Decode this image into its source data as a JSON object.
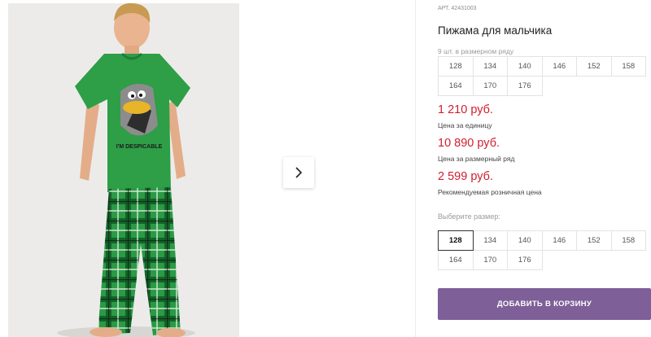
{
  "product": {
    "article_label": "АРТ. 42431003",
    "title": "Пижама для мальчика",
    "shirt_print_text": "I'M DESPICABLE"
  },
  "pack": {
    "note": "9 шт. в размерном ряду",
    "sizes": [
      "128",
      "134",
      "140",
      "146",
      "152",
      "158",
      "164",
      "170",
      "176"
    ]
  },
  "prices": [
    {
      "value": "1 210 руб.",
      "label": "Цена за единицу"
    },
    {
      "value": "10 890 руб.",
      "label": "Цена за размерный ряд"
    },
    {
      "value": "2 599 руб.",
      "label": "Рекомендуемая розничная цена"
    }
  ],
  "size_select": {
    "label": "Выберите размер:",
    "sizes": [
      "128",
      "134",
      "140",
      "146",
      "152",
      "158",
      "164",
      "170",
      "176"
    ],
    "selected": "128"
  },
  "add_to_cart_label": "ДОБАВИТЬ В КОРЗИНУ",
  "colors": {
    "price_red": "#cf1f2e",
    "button_purple": "#7e5f98",
    "shirt_green": "#2e9e47",
    "plaid_green": "#1f8a37"
  },
  "icons": {
    "gallery_next": "chevron-right-icon"
  }
}
